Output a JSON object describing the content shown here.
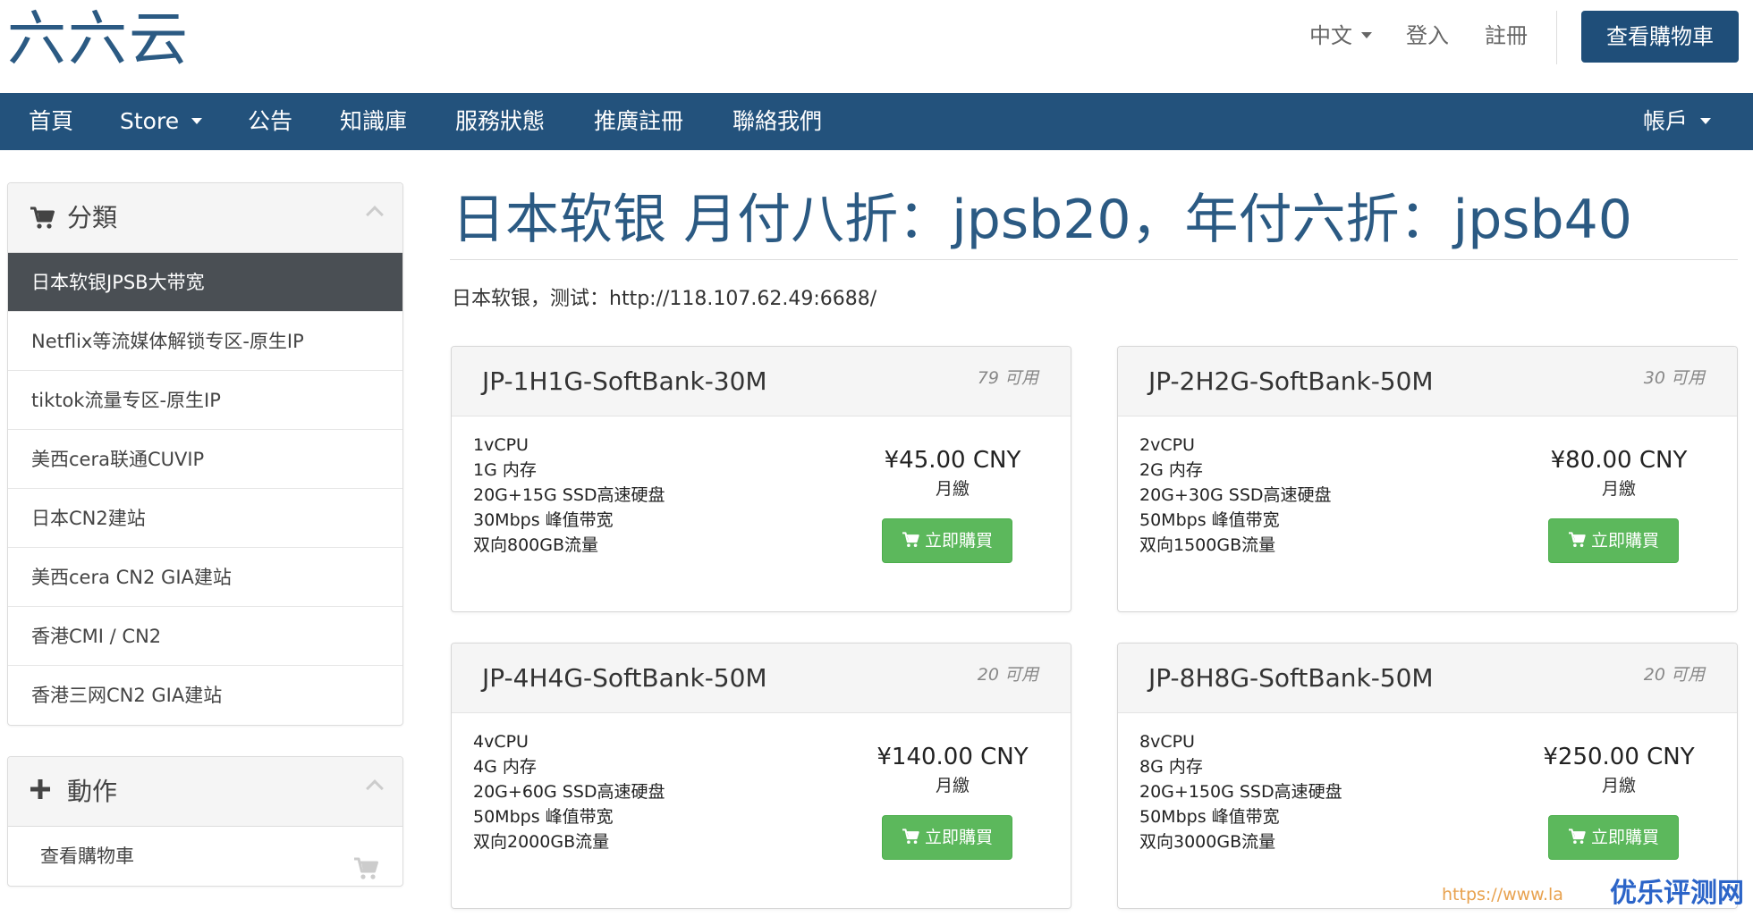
{
  "header": {
    "logo": "六六云",
    "language": "中文",
    "login": "登入",
    "register": "註冊",
    "view_cart": "查看購物車"
  },
  "nav": {
    "items": [
      {
        "label": "首頁"
      },
      {
        "label": "Store"
      },
      {
        "label": "公告"
      },
      {
        "label": "知識庫"
      },
      {
        "label": "服務狀態"
      },
      {
        "label": "推廣註冊"
      },
      {
        "label": "聯絡我們"
      }
    ],
    "account": "帳戶"
  },
  "sidebar": {
    "categories_title": "分類",
    "categories": [
      {
        "label": "日本软银JPSB大带宽",
        "active": true
      },
      {
        "label": "Netflix等流媒体解锁专区-原生IP"
      },
      {
        "label": "tiktok流量专区-原生IP"
      },
      {
        "label": "美西cera联通CUVIP"
      },
      {
        "label": "日本CN2建站"
      },
      {
        "label": "美西cera CN2 GIA建站"
      },
      {
        "label": "香港CMI / CN2"
      },
      {
        "label": "香港三网CN2 GIA建站"
      }
    ],
    "actions_title": "動作",
    "actions": [
      {
        "label": "查看購物車"
      }
    ]
  },
  "main": {
    "title": "日本软银 月付八折：jpsb20，年付六折：jpsb40",
    "subtitle": "日本软银，测试：http://118.107.62.49:6688/",
    "products": [
      {
        "name": "JP-1H1G-SoftBank-30M",
        "available": "79 可用",
        "specs": [
          "1vCPU",
          "1G 内存",
          "20G+15G SSD高速硬盘",
          "30Mbps 峰值带宽",
          "双向800GB流量"
        ],
        "price": "¥45.00 CNY",
        "cycle": "月繳",
        "buy_label": "立即購買"
      },
      {
        "name": "JP-2H2G-SoftBank-50M",
        "available": "30 可用",
        "specs": [
          "2vCPU",
          "2G 内存",
          "20G+30G SSD高速硬盘",
          "50Mbps 峰值带宽",
          "双向1500GB流量"
        ],
        "price": "¥80.00 CNY",
        "cycle": "月繳",
        "buy_label": "立即購買"
      },
      {
        "name": "JP-4H4G-SoftBank-50M",
        "available": "20 可用",
        "specs": [
          "4vCPU",
          "4G 内存",
          "20G+60G SSD高速硬盘",
          "50Mbps 峰值带宽",
          "双向2000GB流量"
        ],
        "price": "¥140.00 CNY",
        "cycle": "月繳",
        "buy_label": "立即購買"
      },
      {
        "name": "JP-8H8G-SoftBank-50M",
        "available": "20 可用",
        "specs": [
          "8vCPU",
          "8G 内存",
          "20G+150G SSD高速硬盘",
          "50Mbps 峰值带宽",
          "双向3000GB流量"
        ],
        "price": "¥250.00 CNY",
        "cycle": "月繳",
        "buy_label": "立即購買"
      }
    ]
  },
  "watermark": {
    "url": "https://www.la",
    "brand": "优乐评测网"
  },
  "colors": {
    "brand_blue": "#23527c",
    "buy_green": "#5cb85c",
    "active_gray": "#4a4f54"
  },
  "icons": {
    "cart": "shopping-cart-icon",
    "plus": "plus-icon",
    "collapse": "chevron-up-icon"
  }
}
